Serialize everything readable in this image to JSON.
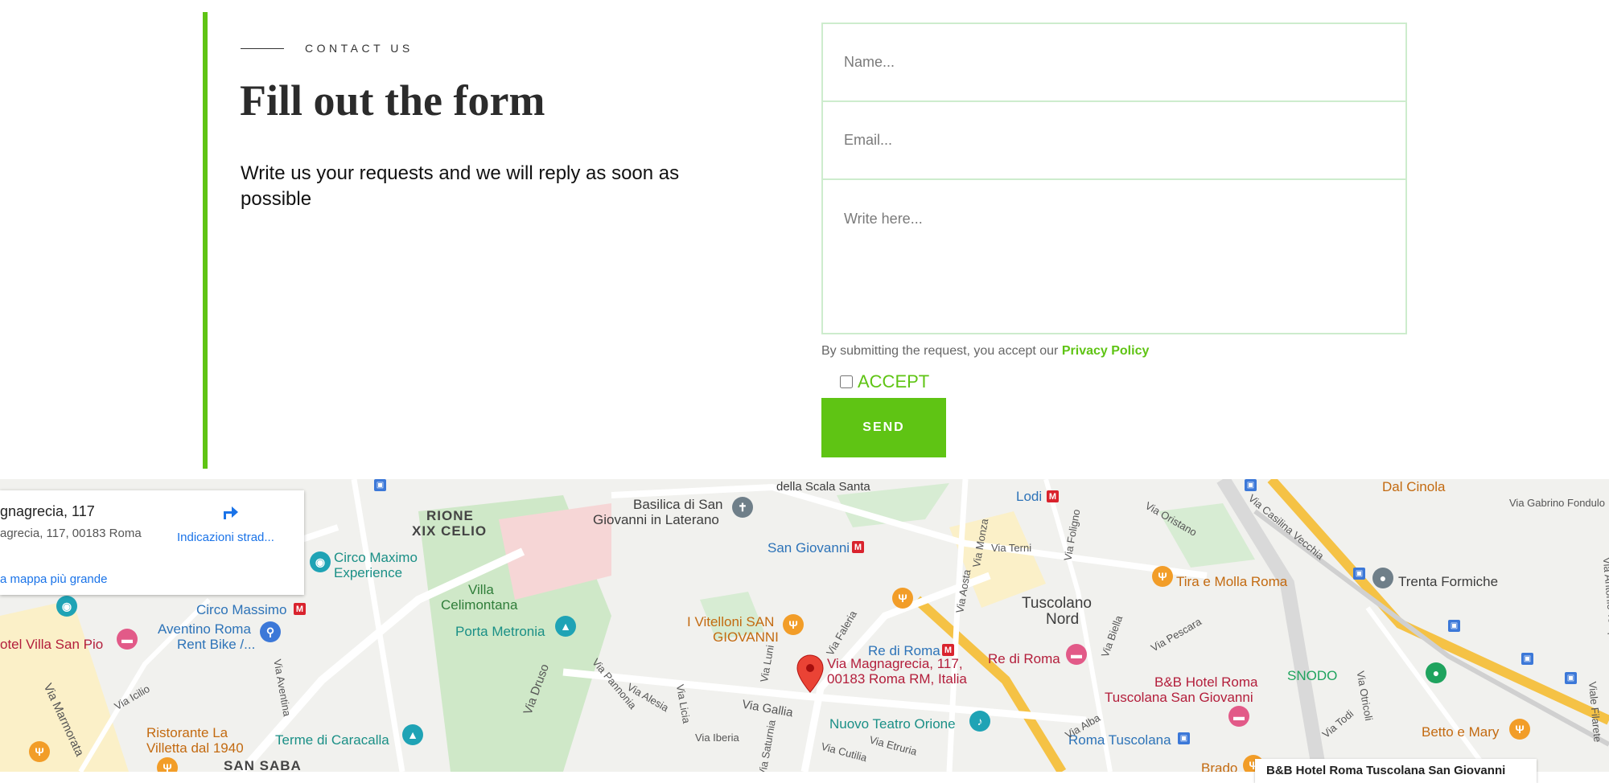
{
  "contact": {
    "eyebrow": "CONTACT US",
    "heading": "Fill out the form",
    "subtext": "Write us your requests and we will reply as soon as possible"
  },
  "form": {
    "name_placeholder": "Name...",
    "email_placeholder": "Email...",
    "message_placeholder": "Write here...",
    "policy_text": "By submitting the request, you accept our",
    "policy_link": "Privacy Policy",
    "accept_label": "ACCEPT",
    "send_label": "SEND"
  },
  "colors": {
    "accent": "#5fc414",
    "field_border": "#cdeccd"
  },
  "map": {
    "info_card": {
      "title": "gnagrecia, 117",
      "address": "agrecia, 117, 00183 Roma",
      "directions": "Indicazioni strad...",
      "bigger_map": "a mappa più grande"
    },
    "marker_label_line1": "Via Magnagrecia, 117,",
    "marker_label_line2": "00183 Roma RM, Italia",
    "labels": {
      "rione_1": "RIONE",
      "rione_2": "XIX CELIO",
      "basilica_1": "Basilica di San",
      "basilica_2": "Giovanni in Laterano",
      "lodi": "Lodi",
      "san_giovanni": "San Giovanni",
      "circo_exp_1": "Circo Maximo",
      "circo_exp_2": "Experience",
      "villa_1": "Villa",
      "villa_2": "Celimontana",
      "porta_metronia": "Porta Metronia",
      "circo_massimo": "Circo Massimo",
      "aventino_1": "Aventino Roma",
      "aventino_2": "Rent Bike /...",
      "hotel_villa": "otel Villa San Pio",
      "vitelloni_1": "I Vitelloni SAN",
      "vitelloni_2": "GIOVANNI",
      "tuscolano_1": "Tuscolano",
      "tuscolano_2": "Nord",
      "tira_molla": "Tira e Molla Roma",
      "trenta_formiche": "Trenta Formiche",
      "re_di_roma_m": "Re di Roma",
      "re_di_roma": "Re di Roma",
      "snodo": "SNODO",
      "bb_hotel_1": "B&B Hotel Roma",
      "bb_hotel_2": "Tuscolana San Giovanni",
      "ristorante_1": "Ristorante La",
      "ristorante_2": "Villetta dal 1940",
      "terme": "Terme di Caracalla",
      "nuovo_teatro": "Nuovo Teatro Orione",
      "roma_tuscolana": "Roma Tuscolana",
      "betto_mary": "Betto e Mary",
      "san_saba": "SAN SABA",
      "dal_cinola": "Dal Cinola",
      "scala_santa": "della Scala Santa",
      "brado": "Brado",
      "bottom_card": "B&B Hotel Roma Tuscolana San Giovanni"
    },
    "streets": {
      "via_monza": "Via Monza",
      "via_aosta": "Via Aosta",
      "via_terni": "Via Terni",
      "via_foligno": "Via Foligno",
      "via_oristano": "Via Oristano",
      "via_casilina": "Via Casilina Vecchia",
      "via_gabrino": "Via Gabrino Fondulo",
      "via_faleria": "Via Faleria",
      "via_pescara": "Via Pescara",
      "via_biella": "Via Biella",
      "via_drusco": "Via Druso",
      "via_pannonia": "Via Pannonia",
      "via_alesia": "Via Alesia",
      "via_licia": "Via Licia",
      "via_luni": "Via Luni",
      "via_gallia": "Via Gallia",
      "via_iberia": "Via Iberia",
      "via_saturnia": "Via Saturnia",
      "via_cutilia": "Via Cutilia",
      "via_etruria": "Via Etruria",
      "via_alba": "Via Alba",
      "via_todi": "Via Todi",
      "via_otricoli": "Via Otricoli",
      "via_icilio": "Via Icilio",
      "via_aventina": "Via Aventina",
      "via_marmorata": "Via Marmorata",
      "via_tempesta": "Via Antonio Tempesta",
      "via_filarete": "Viale Filarete"
    }
  }
}
